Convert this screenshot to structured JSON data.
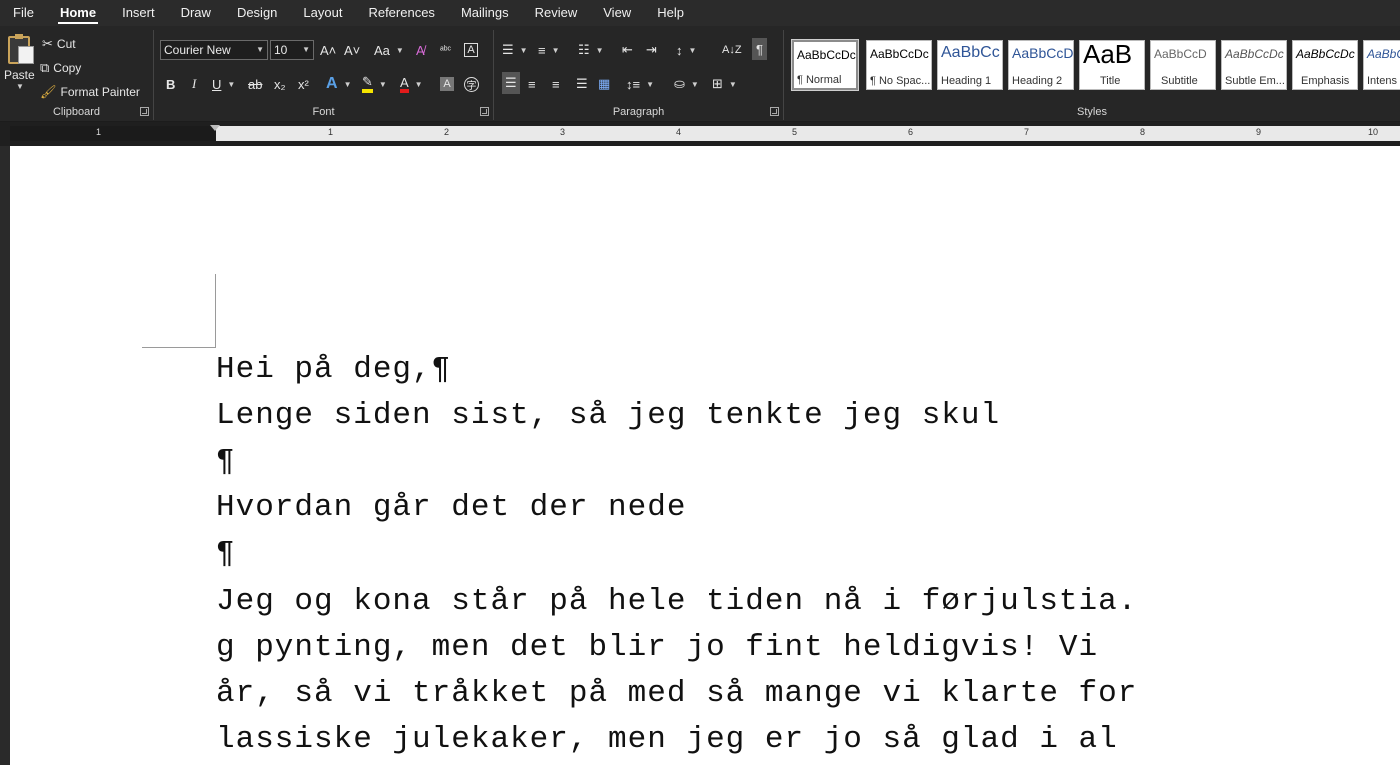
{
  "menu": {
    "tabs": [
      "File",
      "Home",
      "Insert",
      "Draw",
      "Design",
      "Layout",
      "References",
      "Mailings",
      "Review",
      "View",
      "Help"
    ],
    "active_tab": "Home"
  },
  "clipboard": {
    "paste_label": "Paste",
    "cut_label": "Cut",
    "copy_label": "Copy",
    "format_painter_label": "Format Painter",
    "group_label": "Clipboard"
  },
  "font": {
    "font_name": "Courier New",
    "font_size": "10",
    "grow_symbol": "A˄",
    "shrink_symbol": "A˅",
    "case_symbol": "Aa",
    "bold_symbol": "B",
    "italic_symbol": "I",
    "underline_symbol": "U",
    "strike_symbol": "ab",
    "subscript_symbol": "x₂",
    "superscript_symbol": "x²",
    "effects_symbol": "A",
    "color_symbol": "A",
    "group_label": "Font",
    "highlight_color": "#f5e400",
    "font_color": "#e21b1b"
  },
  "paragraph": {
    "group_label": "Paragraph",
    "pilcrow_symbol": "¶"
  },
  "styles": {
    "group_label": "Styles",
    "items": [
      {
        "sample": "AaBbCcDc",
        "name": "¶ Normal"
      },
      {
        "sample": "AaBbCcDc",
        "name": "¶ No Spac..."
      },
      {
        "sample": "AaBbCc",
        "name": "Heading 1"
      },
      {
        "sample": "AaBbCcD",
        "name": "Heading 2"
      },
      {
        "sample": "AaB",
        "name": "Title"
      },
      {
        "sample": "AaBbCcD",
        "name": "Subtitle"
      },
      {
        "sample": "AaBbCcDc",
        "name": "Subtle Em..."
      },
      {
        "sample": "AaBbCcDc",
        "name": "Emphasis"
      },
      {
        "sample": "AaBbCcDc",
        "name": "Intens"
      }
    ],
    "heading_color": "#2f5597"
  },
  "ruler": {
    "numbers": [
      "1",
      "1",
      "2",
      "3",
      "4",
      "5",
      "6",
      "7",
      "8",
      "9",
      "10"
    ]
  },
  "document": {
    "lines": [
      {
        "text": "Hei på deg,¶"
      },
      {
        "text": "Lenge siden sist, så jeg tenkte jeg skul"
      },
      {
        "text": "¶"
      },
      {
        "text": "Hvordan går det der nede"
      },
      {
        "text": "¶"
      },
      {
        "text": "Jeg og kona står på hele tiden nå i førjulstia."
      },
      {
        "text": "g pynting, men det blir jo fint heldigvis! Vi"
      },
      {
        "text": "år, så vi tråkket på med så mange vi klarte for"
      },
      {
        "text": "lassiske julekaker, men jeg er jo så glad i al"
      }
    ]
  }
}
